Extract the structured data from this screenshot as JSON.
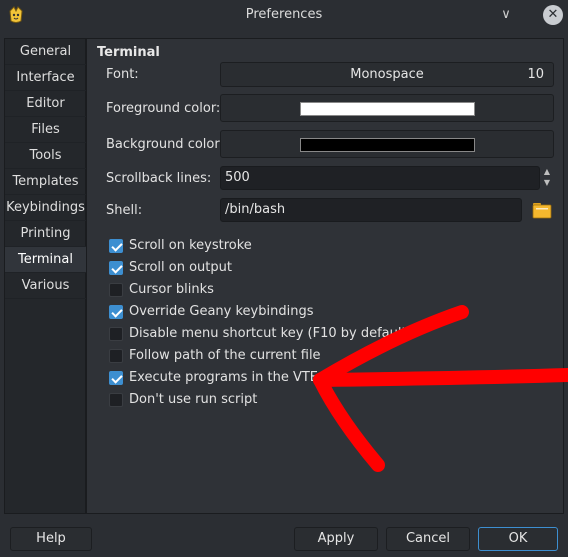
{
  "window": {
    "title": "Preferences",
    "minimize_glyph": "∨",
    "close_glyph": "✕",
    "app_icon": "geany-icon"
  },
  "sidebar": {
    "tabs": [
      {
        "label": "General"
      },
      {
        "label": "Interface"
      },
      {
        "label": "Editor"
      },
      {
        "label": "Files"
      },
      {
        "label": "Tools"
      },
      {
        "label": "Templates"
      },
      {
        "label": "Keybindings"
      },
      {
        "label": "Printing"
      },
      {
        "label": "Terminal",
        "active": true
      },
      {
        "label": "Various"
      }
    ]
  },
  "terminal": {
    "section_title": "Terminal",
    "font_label": "Font:",
    "font_name": "Monospace",
    "font_size": "10",
    "fg_label": "Foreground color:",
    "fg_color": "#ffffff",
    "bg_label": "Background color:",
    "bg_color": "#000000",
    "scrollback_label": "Scrollback lines:",
    "scrollback_value": "500",
    "spin_up": "▲",
    "spin_down": "▼",
    "shell_label": "Shell:",
    "shell_value": "/bin/bash",
    "shell_browse_icon": "folder-icon",
    "options": [
      {
        "label": "Scroll on keystroke",
        "checked": true
      },
      {
        "label": "Scroll on output",
        "checked": true
      },
      {
        "label": "Cursor blinks",
        "checked": false
      },
      {
        "label": "Override Geany keybindings",
        "checked": true
      },
      {
        "label": "Disable menu shortcut key (F10 by default)",
        "checked": false
      },
      {
        "label": "Follow path of the current file",
        "checked": false
      },
      {
        "label": "Execute programs in the VTE",
        "checked": true
      },
      {
        "label": "Don't use run script",
        "checked": false
      }
    ]
  },
  "buttons": {
    "help": "Help",
    "apply": "Apply",
    "cancel": "Cancel",
    "ok": "OK"
  },
  "colors": {
    "accent": "#3d8fd1",
    "annotation": "#ff0000"
  }
}
